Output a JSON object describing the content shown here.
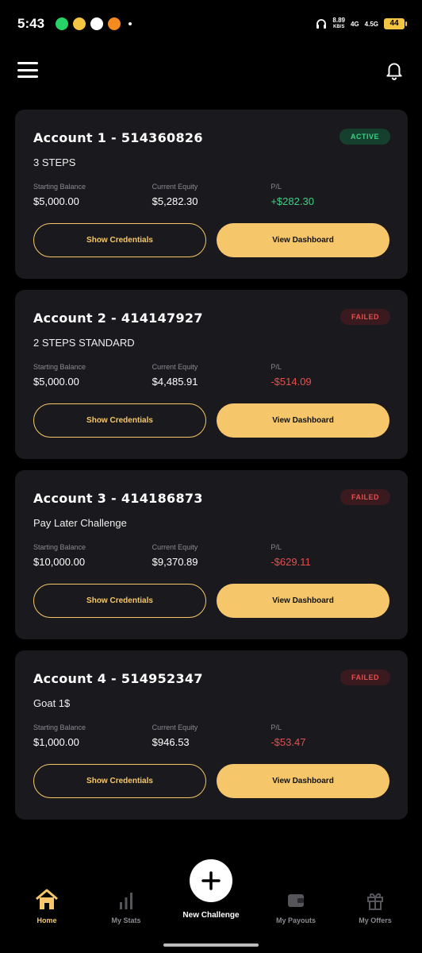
{
  "status_bar": {
    "time": "5:43",
    "net_speed_top": "8.89",
    "net_speed_unit": "KB/S",
    "net1": "4G",
    "net2": "4.5G",
    "battery": "44"
  },
  "accounts": [
    {
      "title": "Account 1 - 514360826",
      "plan": "3 STEPS",
      "status": "ACTIVE",
      "starting_balance_label": "Starting Balance",
      "starting_balance": "$5,000.00",
      "current_equity_label": "Current Equity",
      "current_equity": "$5,282.30",
      "pl_label": "P/L",
      "pl": "+$282.30",
      "show_credentials": "Show Credentials",
      "view_dashboard": "View Dashboard"
    },
    {
      "title": "Account 2 - 414147927",
      "plan": "2 STEPS STANDARD",
      "status": "FAILED",
      "starting_balance_label": "Starting Balance",
      "starting_balance": "$5,000.00",
      "current_equity_label": "Current Equity",
      "current_equity": "$4,485.91",
      "pl_label": "P/L",
      "pl": "-$514.09",
      "show_credentials": "Show Credentials",
      "view_dashboard": "View Dashboard"
    },
    {
      "title": "Account 3 - 414186873",
      "plan": "Pay Later Challenge",
      "status": "FAILED",
      "starting_balance_label": "Starting Balance",
      "starting_balance": "$10,000.00",
      "current_equity_label": "Current Equity",
      "current_equity": "$9,370.89",
      "pl_label": "P/L",
      "pl": "-$629.11",
      "show_credentials": "Show Credentials",
      "view_dashboard": "View Dashboard"
    },
    {
      "title": "Account 4 - 514952347",
      "plan": "Goat 1$",
      "status": "FAILED",
      "starting_balance_label": "Starting Balance",
      "starting_balance": "$1,000.00",
      "current_equity_label": "Current Equity",
      "current_equity": "$946.53",
      "pl_label": "P/L",
      "pl": "-$53.47",
      "show_credentials": "Show Credentials",
      "view_dashboard": "View Dashboard"
    }
  ],
  "bottom_nav": {
    "home": "Home",
    "stats": "My Stats",
    "new_challenge": "New Challenge",
    "payouts": "My Payouts",
    "offers": "My Offers"
  },
  "colors": {
    "accent": "#f6c76a",
    "positive": "#3ecf85",
    "negative": "#e0504f",
    "card_bg": "#1a1a1e"
  }
}
